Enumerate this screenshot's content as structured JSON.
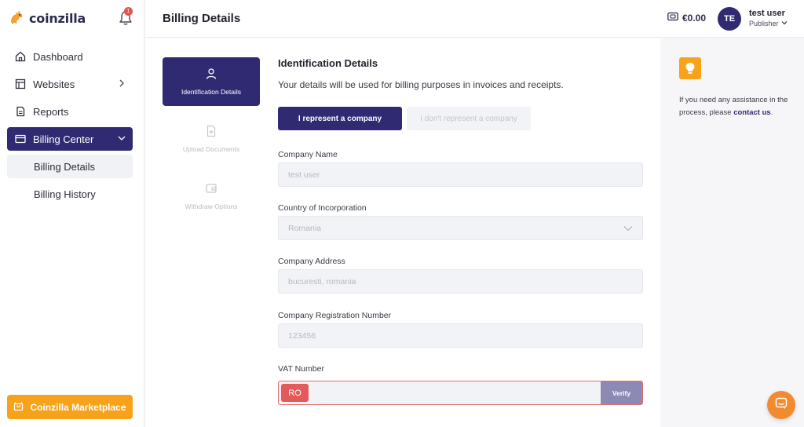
{
  "app": {
    "brand": "coinzilla",
    "notification_count": "1"
  },
  "sidebar": {
    "items": [
      {
        "label": "Dashboard",
        "icon": "home-icon"
      },
      {
        "label": "Websites",
        "icon": "layout-icon"
      },
      {
        "label": "Reports",
        "icon": "document-icon"
      },
      {
        "label": "Billing Center",
        "icon": "card-icon"
      }
    ],
    "subitems": [
      {
        "label": "Billing Details"
      },
      {
        "label": "Billing History"
      }
    ],
    "marketplace_label": "Coinzilla Marketplace"
  },
  "header": {
    "title": "Billing Details",
    "balance": "€0.00",
    "avatar_initials": "TE",
    "user_name": "test user",
    "user_role": "Publisher"
  },
  "steps": [
    {
      "label": "Identification Details",
      "icon": "user-icon"
    },
    {
      "label": "Upload Documents",
      "icon": "file-plus-icon"
    },
    {
      "label": "Withdraw Options",
      "icon": "wallet-icon"
    }
  ],
  "form": {
    "title": "Identification Details",
    "description": "Your details will be used for billing purposes in invoices and receipts.",
    "company_toggle": "I represent a company",
    "no_company_toggle": "I don't represent a company",
    "fields": [
      {
        "label": "Company Name",
        "value": "test user"
      },
      {
        "label": "Country of Incorporation",
        "value": "Romania"
      },
      {
        "label": "Company Address",
        "value": "bucuresti, romania"
      },
      {
        "label": "Company Registration Number",
        "value": "123456"
      }
    ],
    "vat": {
      "label": "VAT Number",
      "prefix": "RO",
      "value": "",
      "verify_label": "Verify"
    }
  },
  "help": {
    "text": "If you need any assistance in the process, please",
    "link": "contact us",
    "end": "."
  },
  "colors": {
    "primary": "#2f2a72",
    "accent": "#f7a21b",
    "error": "#e25a5a",
    "chat": "#f28b2f"
  }
}
